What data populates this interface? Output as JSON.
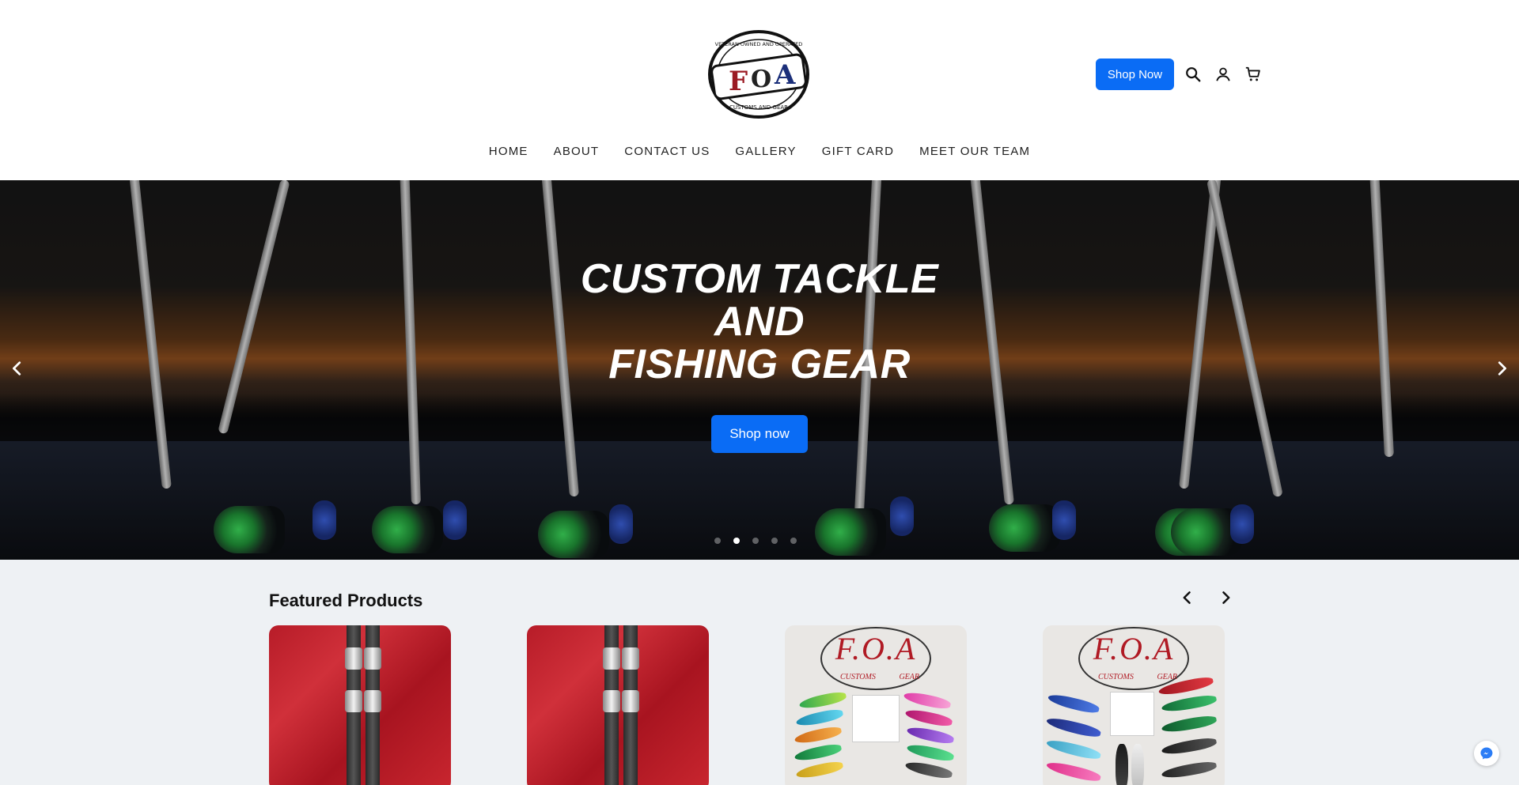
{
  "header": {
    "logo_alt": "F.O.A. Customs and Gear",
    "logo_text": "F.O.A",
    "logo_ring_top": "VETERAN OWNED AND OPERATED",
    "logo_ring_bottom": "CUSTOMS AND GEAR",
    "shop_now_label": "Shop Now",
    "icons": [
      "search-icon",
      "account-icon",
      "cart-icon"
    ]
  },
  "nav": {
    "items": [
      {
        "label": "HOME"
      },
      {
        "label": "ABOUT"
      },
      {
        "label": "CONTACT US"
      },
      {
        "label": "GALLERY"
      },
      {
        "label": "GIFT CARD"
      },
      {
        "label": "MEET OUR TEAM"
      }
    ]
  },
  "hero": {
    "title_line1": "CUSTOM TACKLE",
    "title_line2": "AND",
    "title_line3": "FISHING GEAR",
    "cta_label": "Shop now",
    "slide_count": 5,
    "active_slide": 2
  },
  "featured": {
    "title": "Featured Products",
    "products": [
      {
        "image": "rod-handles-red-towel"
      },
      {
        "image": "rod-handles-red-towel"
      },
      {
        "image": "foa-lures-assorted",
        "brand": "F.O.A",
        "left_tag": "CUSTOMS",
        "right_tag": "GEAR"
      },
      {
        "image": "foa-lures-dark",
        "brand": "F.O.A",
        "left_tag": "CUSTOMS",
        "right_tag": "GEAR"
      }
    ]
  },
  "colors": {
    "accent": "#0a6cf5",
    "featured_bg": "#eef1f4"
  }
}
